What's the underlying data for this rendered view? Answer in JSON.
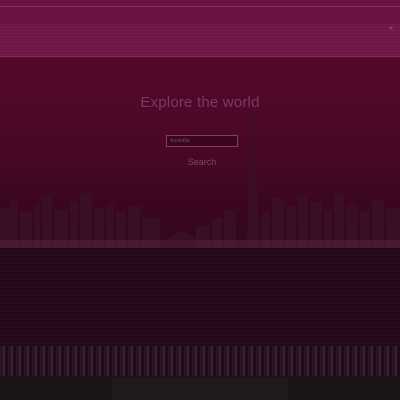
{
  "hero": {
    "title": "Explore the world",
    "search_placeholder": "Australia",
    "search_button": "Search"
  },
  "icons": {
    "close": "close-icon"
  },
  "colors": {
    "background": "#4a0828",
    "title_text": "#7a3a62",
    "input_border": "#8a3a6a"
  }
}
